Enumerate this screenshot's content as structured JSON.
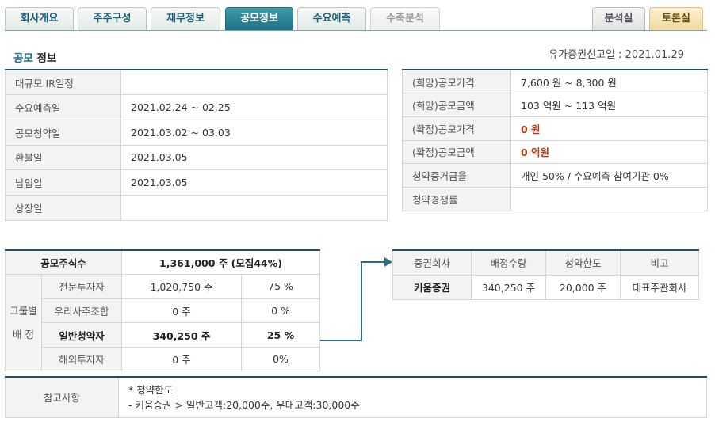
{
  "tabs": [
    {
      "label": "회사개요",
      "state": "normal"
    },
    {
      "label": "주주구성",
      "state": "normal"
    },
    {
      "label": "재무정보",
      "state": "normal"
    },
    {
      "label": "공모정보",
      "state": "active"
    },
    {
      "label": "수요예측",
      "state": "normal"
    },
    {
      "label": "수축분석",
      "state": "disabled"
    }
  ],
  "side_tabs": [
    {
      "label": "분석실"
    },
    {
      "label": "토론실"
    }
  ],
  "section": {
    "title_highlight": "공모",
    "title_rest": " 정보"
  },
  "filing_date": "유가증권신고일 : 2021.01.29",
  "schedule": [
    {
      "label": "대규모 IR일정",
      "value": ""
    },
    {
      "label": "수요예측일",
      "value": "2021.02.24 ~ 02.25"
    },
    {
      "label": "공모청약일",
      "value": "2021.03.02 ~ 03.03"
    },
    {
      "label": "환불일",
      "value": "2021.03.05"
    },
    {
      "label": "납입일",
      "value": "2021.03.05"
    },
    {
      "label": "상장일",
      "value": ""
    }
  ],
  "pricing": [
    {
      "label": "(희망)공모가격",
      "value": "7,600 원 ~ 8,300 원"
    },
    {
      "label": "(희망)공모금액",
      "value": "103 억원  ~ 113 억원"
    },
    {
      "label": "(확정)공모가격",
      "value": "0 원"
    },
    {
      "label": "(확정)공모금액",
      "value": "0 억원"
    },
    {
      "label": "청약증거금율",
      "value": "개인 50% / 수요예측 참여기관 0%"
    },
    {
      "label": "청약경쟁률",
      "value": ""
    }
  ],
  "shares": {
    "total_label": "공모주식수",
    "total_value": "1,361,000 주 (모집44%)",
    "group_label_1": "그룹별",
    "group_label_2": "배 정",
    "rows": [
      {
        "name": "전문투자자",
        "shares": "1,020,750 주",
        "pct": "75 %"
      },
      {
        "name": "우리사주조합",
        "shares": "0 주",
        "pct": "0 %"
      },
      {
        "name": "일반청약자",
        "shares": "340,250 주",
        "pct": "25 %"
      },
      {
        "name": "해외투자자",
        "shares": "0 주",
        "pct": "0%"
      }
    ]
  },
  "broker": {
    "headers": [
      "증권회사",
      "배정수량",
      "청약한도",
      "비고"
    ],
    "row": {
      "name": "키움증권",
      "alloc": "340,250 주",
      "limit": "20,000 주",
      "note": "대표주관회사"
    }
  },
  "notes": {
    "label": "참고사항",
    "line1": "* 청약한도",
    "line2": "- 키움증권 >  일반고객:20,000주, 우대고객:30,000주"
  },
  "colors": {
    "accent": "#1f6f84",
    "active_tab": "#1f6f84",
    "confirmed_value": "#b23a16"
  }
}
